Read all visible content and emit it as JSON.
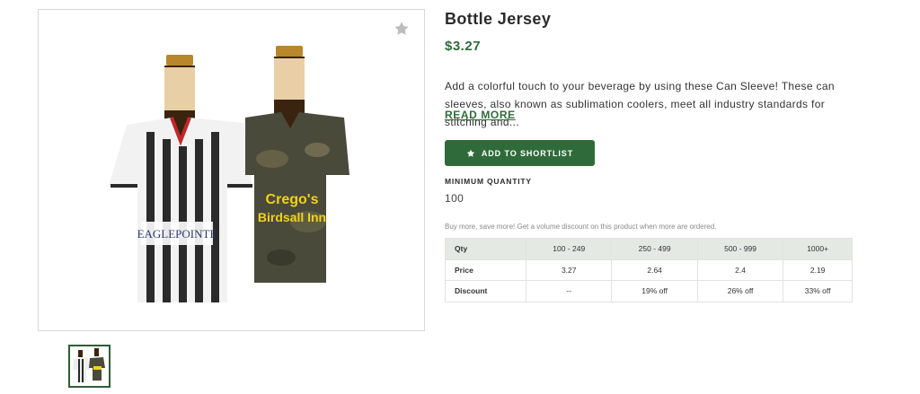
{
  "product": {
    "title": "Bottle Jersey",
    "price": "$3.27",
    "description": "Add a colorful touch to your beverage by using these Can Sleeve! These can sleeves, also known as sublimation coolers, meet all industry standards for stitching and...",
    "read_more_label": "READ MORE",
    "image_text": {
      "left_logo": "EAGLEPOINTE",
      "right_line1": "Crego's",
      "right_line2": "Birdsall Inn"
    }
  },
  "actions": {
    "shortlist_label": "ADD TO SHORTLIST",
    "favorite_icon": "star-icon",
    "shortlist_icon": "star-icon"
  },
  "minimum_quantity": {
    "label": "MINIMUM QUANTITY",
    "value": "100"
  },
  "volume_note": "Buy more, save more! Get a volume discount on this product when more are ordered.",
  "pricing_table": {
    "headers": [
      "Qty",
      "100 - 249",
      "250 - 499",
      "500 - 999",
      "1000+"
    ],
    "rows": [
      {
        "label": "Price",
        "cells": [
          "3.27",
          "2.64",
          "2.4",
          "2.19"
        ]
      },
      {
        "label": "Discount",
        "cells": [
          "--",
          "19% off",
          "26% off",
          "33% off"
        ]
      }
    ]
  },
  "colors": {
    "accent": "#2f6b3a",
    "table_header_bg": "#e4e9e4"
  }
}
